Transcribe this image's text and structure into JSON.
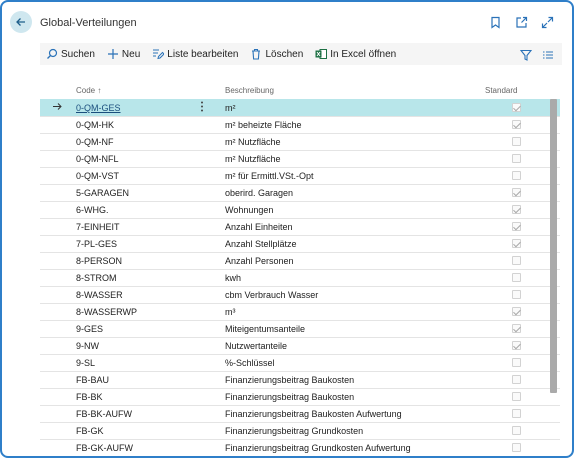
{
  "window": {
    "title": "Global-Verteilungen"
  },
  "actions": {
    "search": "Suchen",
    "new": "Neu",
    "edit_list": "Liste bearbeiten",
    "delete": "Löschen",
    "excel": "In Excel öffnen"
  },
  "grid": {
    "headers": {
      "code": "Code ↑",
      "description": "Beschreibung",
      "standard": "Standard"
    },
    "rows": [
      {
        "code": "0-QM-GES",
        "description": "m²",
        "standard": true
      },
      {
        "code": "0-QM-HK",
        "description": "m² beheizte Fläche",
        "standard": true
      },
      {
        "code": "0-QM-NF",
        "description": "m² Nutzfläche",
        "standard": false
      },
      {
        "code": "0-QM-NFL",
        "description": "m² Nutzfläche",
        "standard": false
      },
      {
        "code": "0-QM-VST",
        "description": "m² für Ermittl.VSt.-Opt",
        "standard": false
      },
      {
        "code": "5-GARAGEN",
        "description": "oberird. Garagen",
        "standard": true
      },
      {
        "code": "6-WHG.",
        "description": "Wohnungen",
        "standard": true
      },
      {
        "code": "7-EINHEIT",
        "description": "Anzahl Einheiten",
        "standard": true
      },
      {
        "code": "7-PL-GES",
        "description": "Anzahl Stellplätze",
        "standard": true
      },
      {
        "code": "8-PERSON",
        "description": "Anzahl Personen",
        "standard": false
      },
      {
        "code": "8-STROM",
        "description": "kwh",
        "standard": false
      },
      {
        "code": "8-WASSER",
        "description": "cbm Verbrauch Wasser",
        "standard": false
      },
      {
        "code": "8-WASSERWP",
        "description": "m³",
        "standard": true
      },
      {
        "code": "9-GES",
        "description": "Miteigentumsanteile",
        "standard": true
      },
      {
        "code": "9-NW",
        "description": "Nutzwertanteile",
        "standard": true
      },
      {
        "code": "9-SL",
        "description": "%-Schlüssel",
        "standard": false
      },
      {
        "code": "FB-BAU",
        "description": "Finanzierungsbeitrag Baukosten",
        "standard": false
      },
      {
        "code": "FB-BK",
        "description": "Finanzierungsbeitrag Baukosten",
        "standard": false
      },
      {
        "code": "FB-BK-AUFW",
        "description": "Finanzierungsbeitrag Baukosten Aufwertung",
        "standard": false
      },
      {
        "code": "FB-GK",
        "description": "Finanzierungsbeitrag Grundkosten",
        "standard": false
      },
      {
        "code": "FB-GK-AUFW",
        "description": "Finanzierungsbeitrag Grundkosten Aufwertung",
        "standard": false
      }
    ]
  },
  "icons": {
    "back": "arrow-left-icon",
    "bookmark": "bookmark-icon",
    "open_new": "open-in-new-window-icon",
    "expand": "expand-icon",
    "search": "search-icon",
    "new": "plus-icon",
    "edit": "edit-list-icon",
    "delete": "trash-icon",
    "excel": "excel-icon",
    "filter": "filter-icon",
    "list": "list-view-icon",
    "row_arrow": "arrow-right-icon",
    "row_menu": "more-vertical-icon"
  },
  "colors": {
    "accent": "#2f7fc9",
    "selected_row": "#b8e6ea",
    "excel_green": "#1d7044"
  }
}
